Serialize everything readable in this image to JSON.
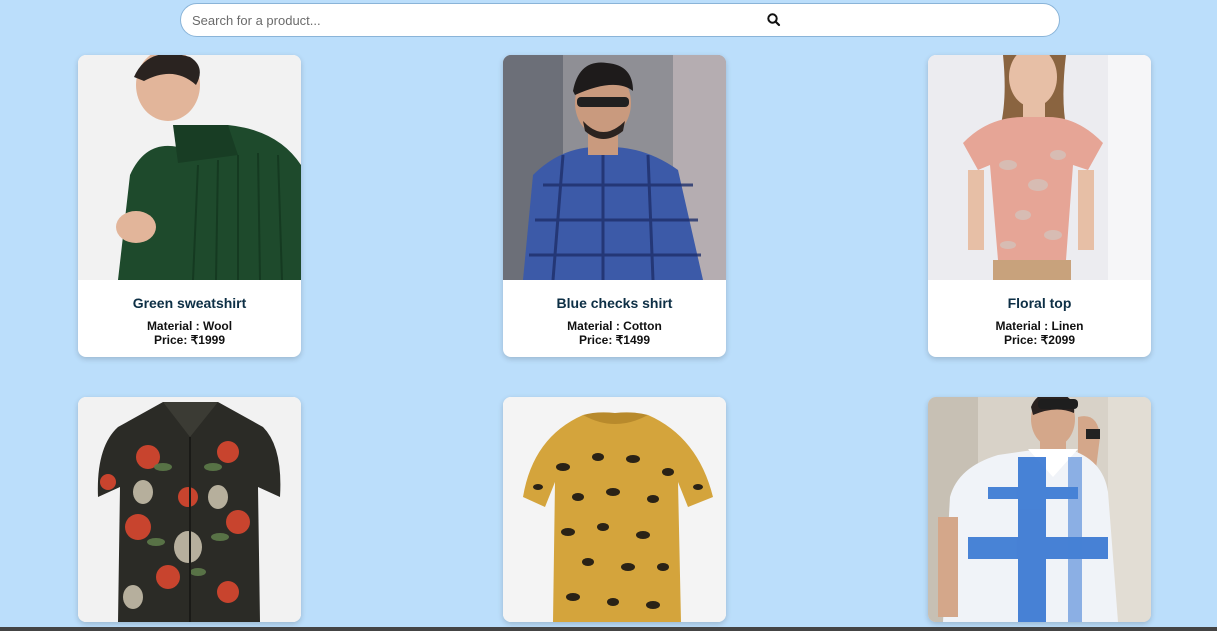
{
  "search": {
    "placeholder": "Search for a product...",
    "icon": "search-icon"
  },
  "products": [
    {
      "name": "Green sweatshirt",
      "material": "Material : Wool",
      "price": "Price: ₹1999",
      "colors": {
        "bg": "#f2f2f2",
        "garment": "#1e4a2c",
        "skin": "#e2b59a",
        "hair": "#2a2320"
      }
    },
    {
      "name": "Blue checks shirt",
      "material": "Material : Cotton",
      "price": "Price: ₹1499",
      "colors": {
        "bg": "#8f8f95",
        "garment": "#3c5aa8",
        "skin": "#c99a7e",
        "hair": "#1e1b1b"
      }
    },
    {
      "name": "Floral top",
      "material": "Material : Linen",
      "price": "Price: ₹2099",
      "colors": {
        "bg": "#ececf0",
        "garment": "#e6a596",
        "skin": "#e7bfa6",
        "hair": "#8a6440",
        "skirt": "#c8a27c"
      }
    },
    {
      "name": "",
      "material": "",
      "price": "",
      "colors": {
        "bg": "#f2f2f2",
        "garment": "#2b2b26",
        "accent": "#c8442e",
        "leaf": "#5d7a4a"
      }
    },
    {
      "name": "",
      "material": "",
      "price": "",
      "colors": {
        "bg": "#f4f4f4",
        "garment": "#d4a43c",
        "accent": "#2a2216"
      }
    },
    {
      "name": "",
      "material": "",
      "price": "",
      "colors": {
        "bg": "#d8d2c8",
        "garment": "#f0f3f8",
        "accent": "#2a6ed0",
        "skin": "#d4a78a",
        "hair": "#2a2220"
      }
    }
  ]
}
